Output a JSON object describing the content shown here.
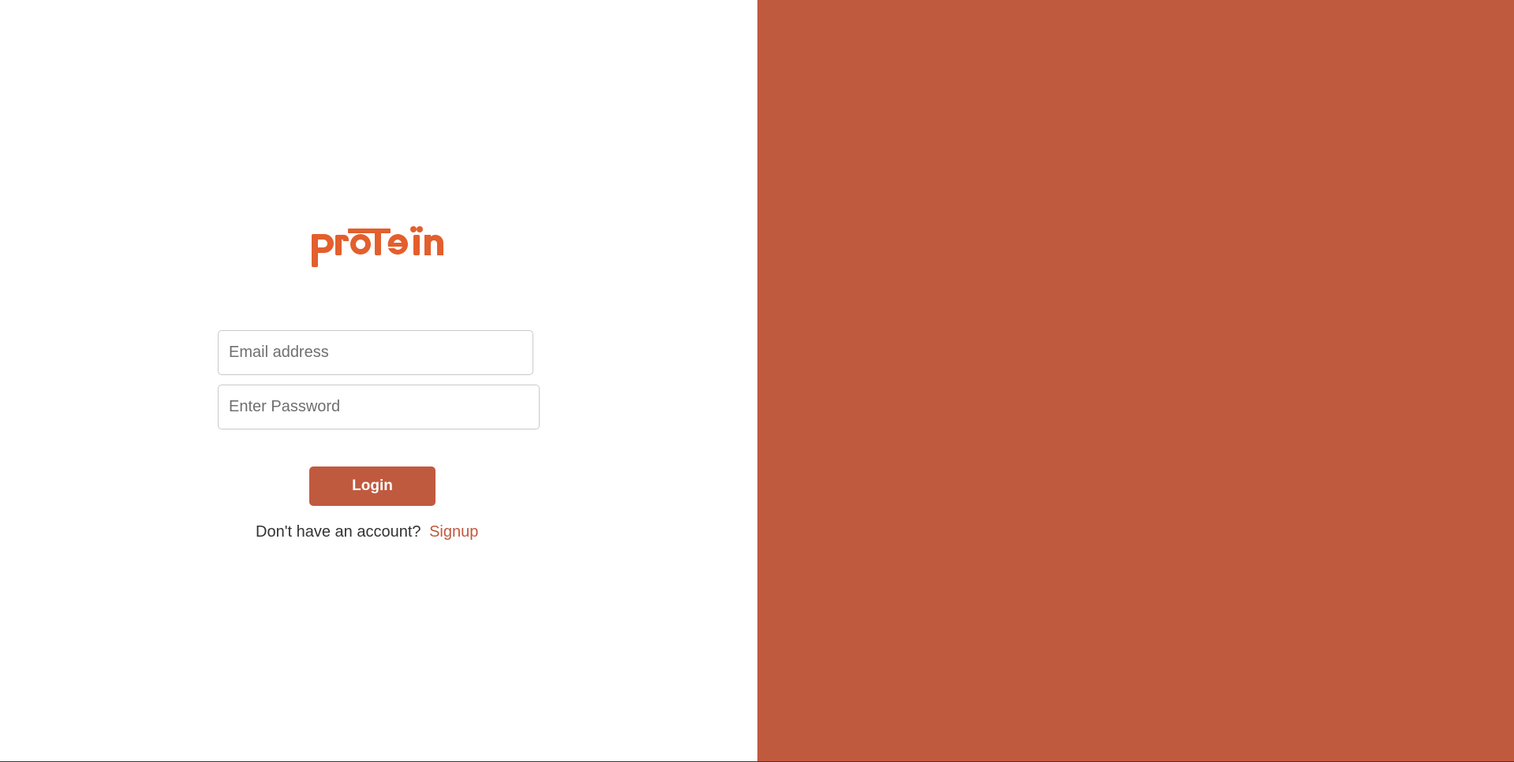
{
  "brand": {
    "logo_text": "protein",
    "color": "#e35f2d"
  },
  "form": {
    "email_placeholder": "Email address",
    "email_value": "",
    "password_placeholder": "Enter Password",
    "password_value": "",
    "login_label": "Login"
  },
  "signup": {
    "prompt": "Don't have an account?",
    "link_label": "Signup"
  },
  "colors": {
    "accent": "#c05a3f",
    "background": "#ffffff",
    "text": "#333333"
  }
}
